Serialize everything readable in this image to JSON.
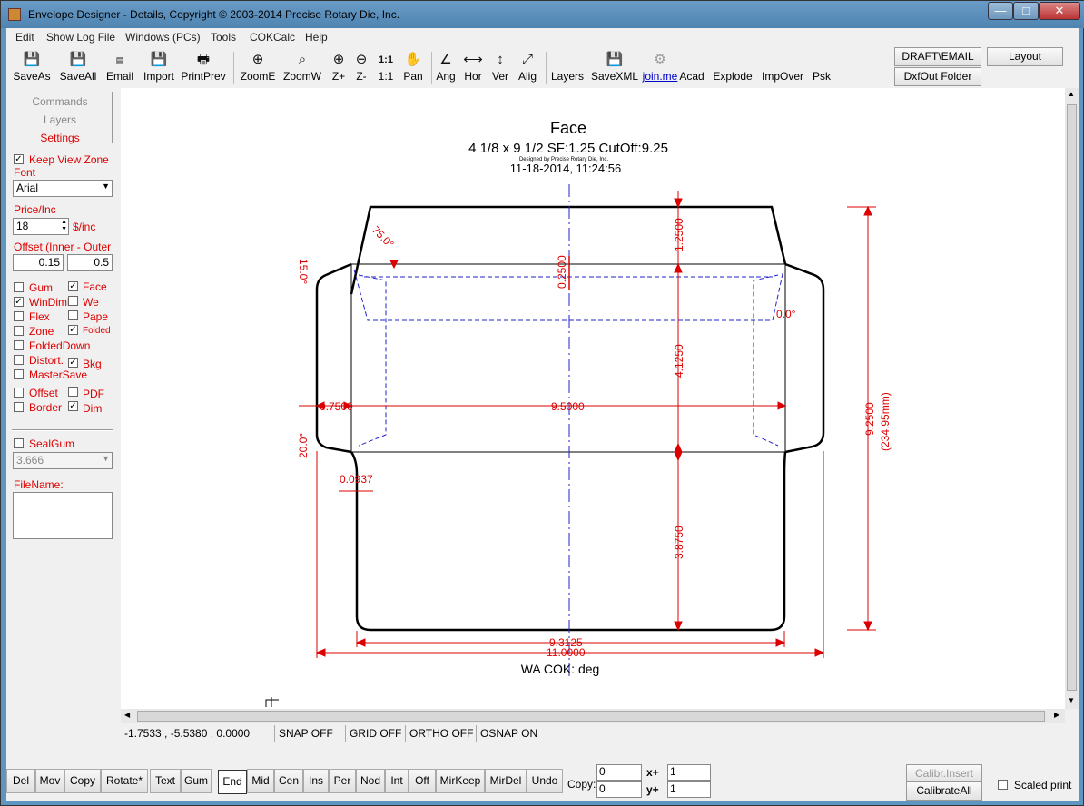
{
  "window": {
    "title": "Envelope Designer - Details,  Copyright © 2003-2014 Precise Rotary Die, Inc.",
    "minimize": "—",
    "maximize": "□",
    "close": "✕"
  },
  "menu": [
    "Edit",
    "Show Log File",
    "Windows (PCs)",
    "Tools",
    "COKCalc",
    "Help"
  ],
  "toolbar": {
    "buttons": [
      "SaveAs",
      "SaveAll",
      "Email",
      "Import",
      "PrintPrev",
      "ZoomE",
      "ZoomW",
      "Z+",
      "Z-",
      "1:1",
      "Pan",
      "Ang",
      "Hor",
      "Ver",
      "Alig",
      "Layers",
      "SaveXML",
      "join.me",
      "Acad",
      "Explode",
      "ImpOver",
      "Psk"
    ],
    "icons": {
      "oneone": "1:1"
    },
    "right": {
      "draft_email": "DRAFT\\EMAIL",
      "dxfout": "DxfOut Folder",
      "layout": "Layout"
    }
  },
  "left_panel": {
    "tabs": [
      "Commands",
      "Layers",
      "Settings"
    ],
    "keep_view_zone": "Keep View Zone",
    "font_label": "Font",
    "font_value": "Arial",
    "price_label": "Price/Inc",
    "price_value": "18",
    "price_unit": "$/inc",
    "offset_label": "Offset (Inner - Outer",
    "offset_inner": "0.15",
    "offset_outer": "0.5",
    "checks": {
      "gum": "Gum",
      "face": "Face",
      "windim": "WinDiml",
      "we": "We",
      "flex": "Flex",
      "pape": "Pape",
      "zone": "Zone",
      "folded": "Folded",
      "foldeddown": "FoldedDown",
      "distort": "Distort.",
      "bkg": "Bkg",
      "mastersave": "MasterSave",
      "offset": "Offset",
      "pdf": "PDF",
      "border": "Border",
      "dim": "Dim"
    },
    "sealgum": "SealGum",
    "sealgum_value": "3.666",
    "filename_label": "FileName:"
  },
  "drawing": {
    "title": "Face",
    "subtitle": "4 1/8 x 9 1/2 SF:1.25 CutOff:9.25",
    "designed_by": "Designed by Precise Rotary Die, Inc.",
    "timestamp": "11-18-2014, 11:24:56",
    "dims": {
      "angle_75": "75.0°",
      "angle_15": "15.0°",
      "angle_0": "0.0°",
      "angle_20": "20.0°",
      "d_1_25": "1.2500",
      "d_0_25": "0.2500",
      "d_4_125": "4.1250",
      "d_3_875": "3.8750",
      "d_0_75": "0.7500",
      "d_9_5": "9.5000",
      "d_0_0937": "0.0937",
      "d_9_25": "9.2500",
      "d_mm": "(234.95mm)",
      "d_9_3125": "9.3125",
      "d_11": "11.0000"
    },
    "footer": "WA COK:  deg"
  },
  "status": {
    "coords": "-1.7533 , -5.5380 , 0.0000",
    "snap": "SNAP OFF",
    "grid": "GRID OFF",
    "ortho": "ORTHO OFF",
    "osnap": "OSNAP ON"
  },
  "bottom": {
    "buttons": [
      "Del",
      "Mov",
      "Copy",
      "Rotate*",
      "Text",
      "Gum",
      "End",
      "Mid",
      "Cen",
      "Ins",
      "Per",
      "Nod",
      "Int",
      "Off",
      "MirKeep",
      "MirDel",
      "Undo"
    ],
    "copy_label": "Copy:",
    "copy_a": "0",
    "copy_b": "0",
    "xplus": "x+",
    "yplus": "y+",
    "x_value": "1",
    "y_value": "1",
    "calibr_insert": "Calibr.Insert",
    "calibrate_all": "CalibrateAll",
    "scaled_print": "Scaled print"
  }
}
